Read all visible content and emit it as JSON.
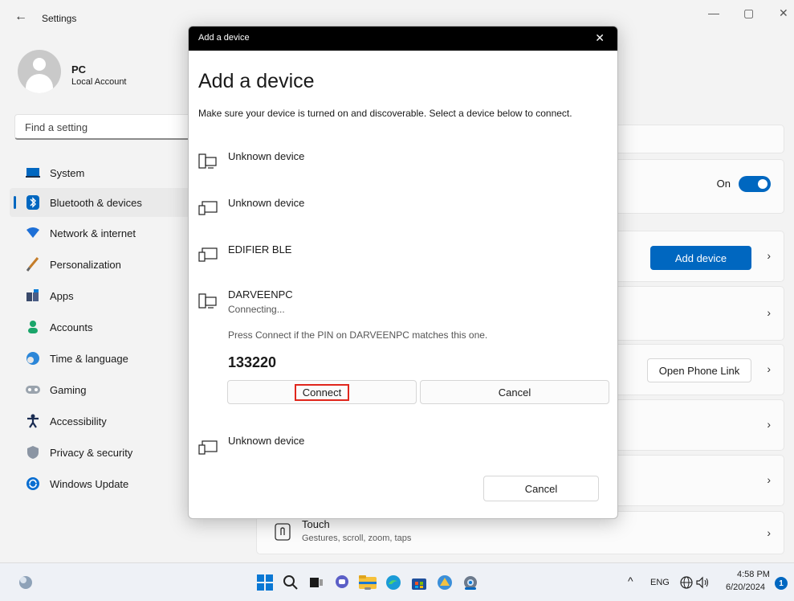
{
  "window": {
    "title": "Settings",
    "back_glyph": "←",
    "min_glyph": "—",
    "max_glyph": "▢",
    "close_glyph": "✕"
  },
  "profile": {
    "name": "PC",
    "account": "Local Account"
  },
  "search": {
    "placeholder": "Find a setting"
  },
  "nav": [
    {
      "label": "System",
      "icon": "system-icon"
    },
    {
      "label": "Bluetooth & devices",
      "icon": "bluetooth-icon",
      "active": true
    },
    {
      "label": "Network & internet",
      "icon": "network-icon"
    },
    {
      "label": "Personalization",
      "icon": "brush-icon"
    },
    {
      "label": "Apps",
      "icon": "apps-icon"
    },
    {
      "label": "Accounts",
      "icon": "person-icon"
    },
    {
      "label": "Time & language",
      "icon": "globe-clock-icon"
    },
    {
      "label": "Gaming",
      "icon": "controller-icon"
    },
    {
      "label": "Accessibility",
      "icon": "accessibility-icon"
    },
    {
      "label": "Privacy & security",
      "icon": "shield-icon"
    },
    {
      "label": "Windows Update",
      "icon": "update-icon"
    }
  ],
  "content": {
    "bluetooth_toggle_label": "On",
    "add_device_button": "Add device",
    "open_phone_link_button": "Open Phone Link",
    "touch": {
      "title": "Touch",
      "subtitle": "Gestures, scroll, zoom, taps"
    },
    "chevron": "›"
  },
  "dialog": {
    "bar_title": "Add a device",
    "close_glyph": "✕",
    "heading": "Add a device",
    "description": "Make sure your device is turned on and discoverable. Select a device below to connect.",
    "devices": [
      {
        "name": "Unknown device",
        "icon": "computer-icon"
      },
      {
        "name": "Unknown device",
        "icon": "generic-device-icon"
      },
      {
        "name": "EDIFIER BLE",
        "icon": "generic-device-icon"
      },
      {
        "name": "DARVEENPC",
        "icon": "computer-icon",
        "status": "Connecting..."
      },
      {
        "name": "Unknown device",
        "icon": "generic-device-icon"
      }
    ],
    "pin_message": "Press Connect if the PIN on DARVEENPC matches this one.",
    "pin": "133220",
    "connect_button": "Connect",
    "cancel_pair_button": "Cancel",
    "cancel_button": "Cancel"
  },
  "taskbar": {
    "tray": {
      "lang": "ENG",
      "time": "4:58 PM",
      "date": "6/20/2024",
      "notifications": "1",
      "chevron_up": "^"
    }
  },
  "colors": {
    "accent": "#0067c0",
    "highlight": "#e0261c"
  }
}
